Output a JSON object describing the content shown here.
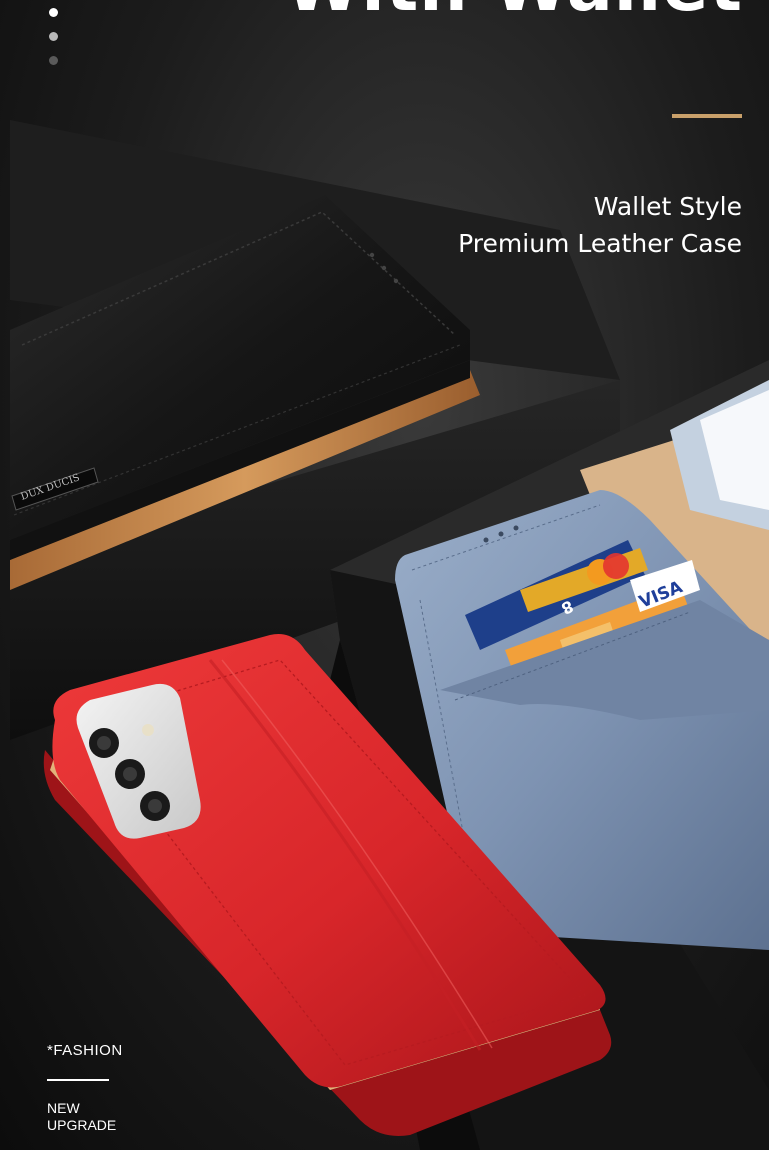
{
  "page": {
    "headline": "With Wallet",
    "subtitle_line1": "Wallet Style",
    "subtitle_line2": "Premium Leather Case",
    "tag_fashion": "*FASHION",
    "tag_new_line1": "NEW",
    "tag_new_line2": "UPGRADE"
  },
  "product": {
    "brand_badge": "DUX DUCIS",
    "visa_text": "VISA",
    "card_fragment": "8"
  },
  "carousel": {
    "dot_count": 3,
    "active_index": 0
  },
  "colors": {
    "accent": "#c9a06a",
    "black_case": "#1a1a1a",
    "red_case": "#d8262a",
    "blue_case": "#7e93b2",
    "tan_inner": "#c68b4f",
    "dot_active": "#ffffff",
    "dot_inactive": "#8a8a8a"
  }
}
